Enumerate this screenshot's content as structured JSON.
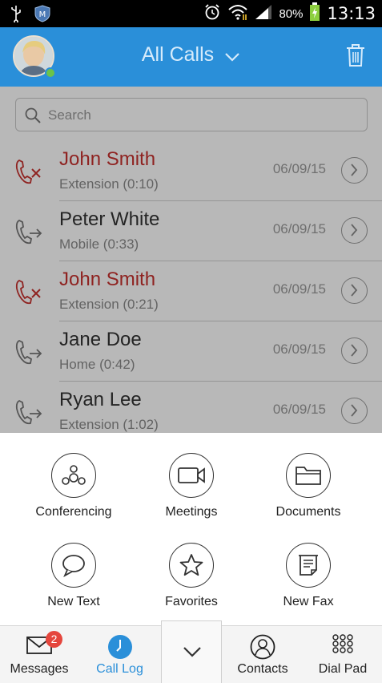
{
  "status_bar": {
    "battery_percent": "80%",
    "time": "13:13"
  },
  "header": {
    "title": "All Calls",
    "avatar_icon": "user-avatar",
    "dropdown_icon": "chevron-down-icon",
    "delete_icon": "trash-icon"
  },
  "search": {
    "placeholder": "Search"
  },
  "calls": [
    {
      "name": "John Smith",
      "detail": "Extension (0:10)",
      "date": "06/09/15",
      "type": "missed"
    },
    {
      "name": "Peter White",
      "detail": "Mobile (0:33)",
      "date": "06/09/15",
      "type": "outgoing"
    },
    {
      "name": "John Smith",
      "detail": "Extension (0:21)",
      "date": "06/09/15",
      "type": "missed"
    },
    {
      "name": "Jane Doe",
      "detail": "Home (0:42)",
      "date": "06/09/15",
      "type": "outgoing"
    },
    {
      "name": "Ryan Lee",
      "detail": "Extension (1:02)",
      "date": "06/09/15",
      "type": "outgoing"
    }
  ],
  "actions": [
    {
      "label": "Conferencing",
      "icon": "conferencing-icon"
    },
    {
      "label": "Meetings",
      "icon": "video-camera-icon"
    },
    {
      "label": "Documents",
      "icon": "folder-icon"
    },
    {
      "label": "New Text",
      "icon": "chat-bubble-icon"
    },
    {
      "label": "Favorites",
      "icon": "star-icon"
    },
    {
      "label": "New Fax",
      "icon": "fax-icon"
    }
  ],
  "tabs": {
    "messages": "Messages",
    "messages_badge": "2",
    "call_log": "Call Log",
    "contacts": "Contacts",
    "dial_pad": "Dial Pad"
  },
  "colors": {
    "header": "#2a8fd9",
    "missed": "#c6312e",
    "active_tab": "#2a8fd9",
    "badge": "#e5463d"
  }
}
